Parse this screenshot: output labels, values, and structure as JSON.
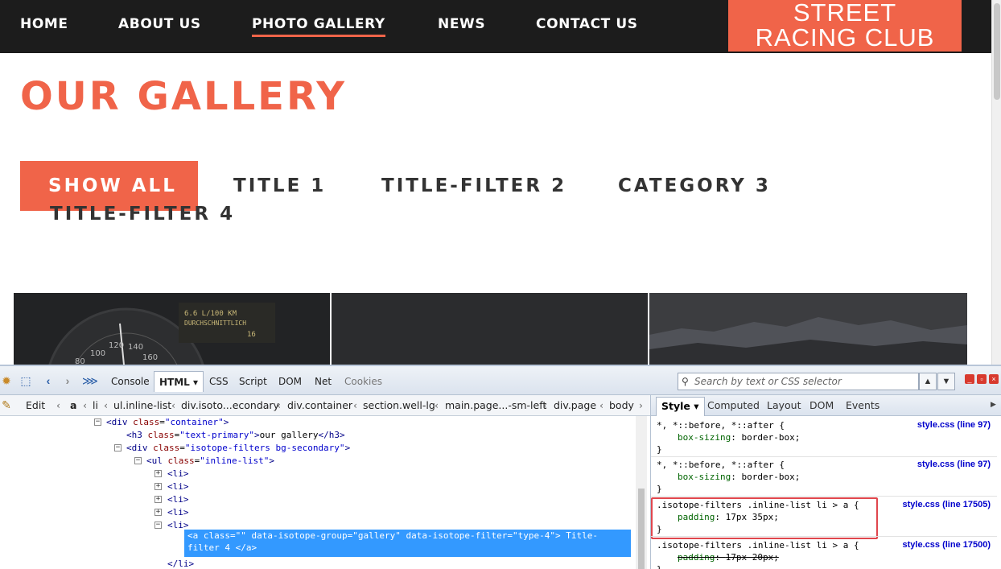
{
  "site": {
    "nav": [
      {
        "label": "HOME"
      },
      {
        "label": "ABOUT US"
      },
      {
        "label": "PHOTO GALLERY"
      },
      {
        "label": "NEWS"
      },
      {
        "label": "CONTACT US"
      }
    ],
    "active_nav": "PHOTO GALLERY",
    "brand_line1": "STREET",
    "brand_line2": "RACING CLUB",
    "gallery_title": "OUR GALLERY",
    "filters": [
      {
        "label": "SHOW ALL"
      },
      {
        "label": "TITLE 1"
      },
      {
        "label": "TITLE-FILTER 2"
      },
      {
        "label": "CATEGORY 3"
      },
      {
        "label": "TITLE-FILTER 4"
      }
    ],
    "photo_dash_text_1": "6.6 L/100 KM",
    "photo_dash_text_2": "DURCHSCHNITTLICH",
    "photo_dash_text_3": "16",
    "gauge_ticks": [
      "100",
      "120",
      "140",
      "160",
      "80"
    ],
    "colors": {
      "accent": "#f06449",
      "nav_bg": "#1c1c1c",
      "filter_text": "#333333"
    }
  },
  "firebug": {
    "main_tabs": [
      {
        "label": "Console"
      },
      {
        "label": "HTML ▾"
      },
      {
        "label": "CSS"
      },
      {
        "label": "Script"
      },
      {
        "label": "DOM"
      },
      {
        "label": "Net"
      },
      {
        "label": "Cookies"
      }
    ],
    "search_placeholder": "Search by text or CSS selector",
    "edit_label": "Edit",
    "breadcrumbs": [
      {
        "label": "a"
      },
      {
        "label": "li"
      },
      {
        "label": "ul.inline-list"
      },
      {
        "label": "div.isoto...econdary"
      },
      {
        "label": "div.container"
      },
      {
        "label": "section.well-lg"
      },
      {
        "label": "main.page...-sm-left"
      },
      {
        "label": "div.page"
      },
      {
        "label": "body"
      }
    ],
    "html_tree": {
      "container_tag": "div",
      "container_attr": "class",
      "container_val": "\"container\"",
      "h3_tag": "h3",
      "h3_attr": "class",
      "h3_val": "\"text-primary\"",
      "h3_text": "our gallery",
      "filters_tag": "div",
      "filters_attr": "class",
      "filters_val": "\"isotope-filters bg-secondary\"",
      "ul_tag": "ul",
      "ul_attr": "class",
      "ul_val": "\"inline-list\"",
      "li_tag": "<li>",
      "li_close": "</li>",
      "selected_line1": "<a class=\"\" data-isotope-group=\"gallery\" data-isotope-filter=\"type-4\"> Title-",
      "selected_line2": "filter 4  </a>"
    },
    "side_tabs": [
      {
        "label": "Style ▾"
      },
      {
        "label": "Computed"
      },
      {
        "label": "Layout"
      },
      {
        "label": "DOM"
      },
      {
        "label": "Events"
      }
    ],
    "css_rules": [
      {
        "selector": "*, *::before, *::after {",
        "prop": "box-sizing",
        "value": "border-box;",
        "source": "style.css (line 97)"
      },
      {
        "selector": "*, *::before, *::after {",
        "prop": "box-sizing",
        "value": "border-box;",
        "source": "style.css (line 97)"
      },
      {
        "selector": ".isotope-filters .inline-list li > a {",
        "prop": "padding",
        "value": "17px 35px;",
        "source": "style.css (line 17505)"
      },
      {
        "selector": ".isotope-filters .inline-list li > a {",
        "prop": "padding",
        "value": "17px 20px;",
        "source": "style.css (line 17500)"
      }
    ],
    "close_brace": "}"
  }
}
